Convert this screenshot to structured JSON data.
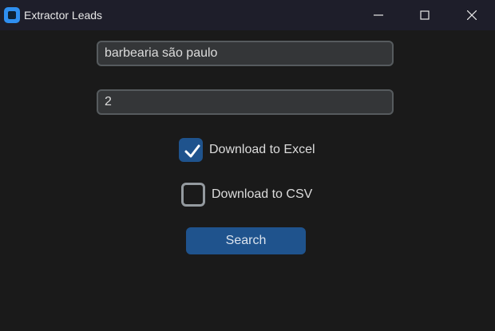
{
  "window": {
    "title": "Extractor Leads",
    "icon": "app-icon"
  },
  "form": {
    "query_value": "barbearia são paulo",
    "count_value": "2",
    "excel_label": "Download to Excel",
    "excel_checked": true,
    "csv_label": "Download to CSV",
    "csv_checked": false,
    "search_label": "Search"
  },
  "colors": {
    "accent": "#1f538d",
    "background": "#1a1a1a",
    "titlebar": "#1e1e2a",
    "input_bg": "#343638",
    "input_border": "#565b5e"
  }
}
